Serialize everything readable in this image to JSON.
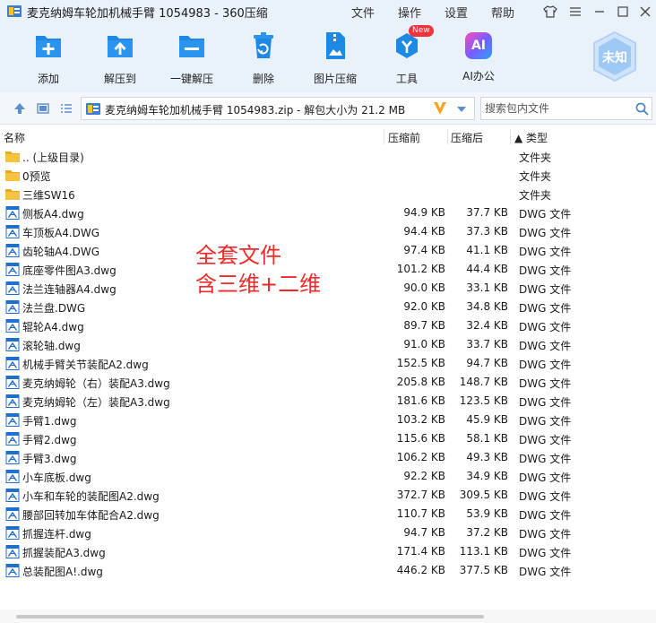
{
  "window": {
    "title": "麦克纳姆车轮加机械手臂 1054983 - 360压缩",
    "menu": [
      "文件",
      "操作",
      "设置",
      "帮助"
    ]
  },
  "toolbar": {
    "items": [
      {
        "label": "添加",
        "icon": "add-icon"
      },
      {
        "label": "解压到",
        "icon": "extract-to-icon"
      },
      {
        "label": "一键解压",
        "icon": "one-click-extract-icon"
      },
      {
        "label": "删除",
        "icon": "delete-icon"
      },
      {
        "label": "图片压缩",
        "icon": "image-compress-icon"
      },
      {
        "label": "工具",
        "icon": "tools-icon",
        "badge": "New"
      },
      {
        "label": "AI办公",
        "icon": "ai-office-icon",
        "icon_text": "AI"
      }
    ],
    "brand_badge": "未知"
  },
  "address": {
    "path": "麦克纳姆车轮加机械手臂 1054983.zip - 解包大小为 21.2 MB",
    "search_placeholder": "搜索包内文件"
  },
  "table": {
    "headers": {
      "name": "名称",
      "packed": "压缩前",
      "compressed": "压缩后",
      "type": "▲ 类型"
    },
    "rows": [
      {
        "kind": "folder",
        "name": ".. (上级目录)",
        "before": "",
        "after": "",
        "type": "文件夹"
      },
      {
        "kind": "folder",
        "name": "0预览",
        "before": "",
        "after": "",
        "type": "文件夹"
      },
      {
        "kind": "folder",
        "name": "三维SW16",
        "before": "",
        "after": "",
        "type": "文件夹"
      },
      {
        "kind": "file",
        "name": "侧板A4.dwg",
        "before": "94.9 KB",
        "after": "37.7 KB",
        "type": "DWG 文件"
      },
      {
        "kind": "file",
        "name": "车顶板A4.DWG",
        "before": "94.4 KB",
        "after": "37.3 KB",
        "type": "DWG 文件"
      },
      {
        "kind": "file",
        "name": "齿轮轴A4.DWG",
        "before": "97.4 KB",
        "after": "41.1 KB",
        "type": "DWG 文件"
      },
      {
        "kind": "file",
        "name": "底座零件图A3.dwg",
        "before": "101.2 KB",
        "after": "44.4 KB",
        "type": "DWG 文件"
      },
      {
        "kind": "file",
        "name": "法兰连轴器A4.dwg",
        "before": "90.0 KB",
        "after": "33.1 KB",
        "type": "DWG 文件"
      },
      {
        "kind": "file",
        "name": "法兰盘.DWG",
        "before": "92.0 KB",
        "after": "34.8 KB",
        "type": "DWG 文件"
      },
      {
        "kind": "file",
        "name": "辊轮A4.dwg",
        "before": "89.7 KB",
        "after": "32.4 KB",
        "type": "DWG 文件"
      },
      {
        "kind": "file",
        "name": "滚轮轴.dwg",
        "before": "91.0 KB",
        "after": "33.7 KB",
        "type": "DWG 文件"
      },
      {
        "kind": "file",
        "name": "机械手臂关节装配A2.dwg",
        "before": "152.5 KB",
        "after": "94.7 KB",
        "type": "DWG 文件"
      },
      {
        "kind": "file",
        "name": "麦克纳姆轮（右）装配A3.dwg",
        "before": "205.8 KB",
        "after": "148.7 KB",
        "type": "DWG 文件"
      },
      {
        "kind": "file",
        "name": "麦克纳姆轮（左）装配A3.dwg",
        "before": "181.6 KB",
        "after": "123.5 KB",
        "type": "DWG 文件"
      },
      {
        "kind": "file",
        "name": "手臂1.dwg",
        "before": "103.2 KB",
        "after": "45.9 KB",
        "type": "DWG 文件"
      },
      {
        "kind": "file",
        "name": "手臂2.dwg",
        "before": "115.6 KB",
        "after": "58.1 KB",
        "type": "DWG 文件"
      },
      {
        "kind": "file",
        "name": "手臂3.dwg",
        "before": "106.2 KB",
        "after": "49.3 KB",
        "type": "DWG 文件"
      },
      {
        "kind": "file",
        "name": "小车底板.dwg",
        "before": "92.2 KB",
        "after": "34.9 KB",
        "type": "DWG 文件"
      },
      {
        "kind": "file",
        "name": "小车和车轮的装配图A2.dwg",
        "before": "372.7 KB",
        "after": "309.5 KB",
        "type": "DWG 文件"
      },
      {
        "kind": "file",
        "name": "腰部回转加车体配合A2.dwg",
        "before": "110.7 KB",
        "after": "53.9 KB",
        "type": "DWG 文件"
      },
      {
        "kind": "file",
        "name": "抓握连杆.dwg",
        "before": "94.7 KB",
        "after": "37.2 KB",
        "type": "DWG 文件"
      },
      {
        "kind": "file",
        "name": "抓握装配A3.dwg",
        "before": "171.4 KB",
        "after": "113.1 KB",
        "type": "DWG 文件"
      },
      {
        "kind": "file",
        "name": "总装配图A!.dwg",
        "before": "446.2 KB",
        "after": "377.5 KB",
        "type": "DWG 文件"
      }
    ]
  },
  "annotation": {
    "line1": "全套文件",
    "line2": "含三维+二维",
    "color": "#f02a2a"
  },
  "colors": {
    "accent": "#1e88e5",
    "folder": "#f5c242",
    "file_icon": "#1f6fd1",
    "toolbar_bg": "#e9f1fb"
  }
}
